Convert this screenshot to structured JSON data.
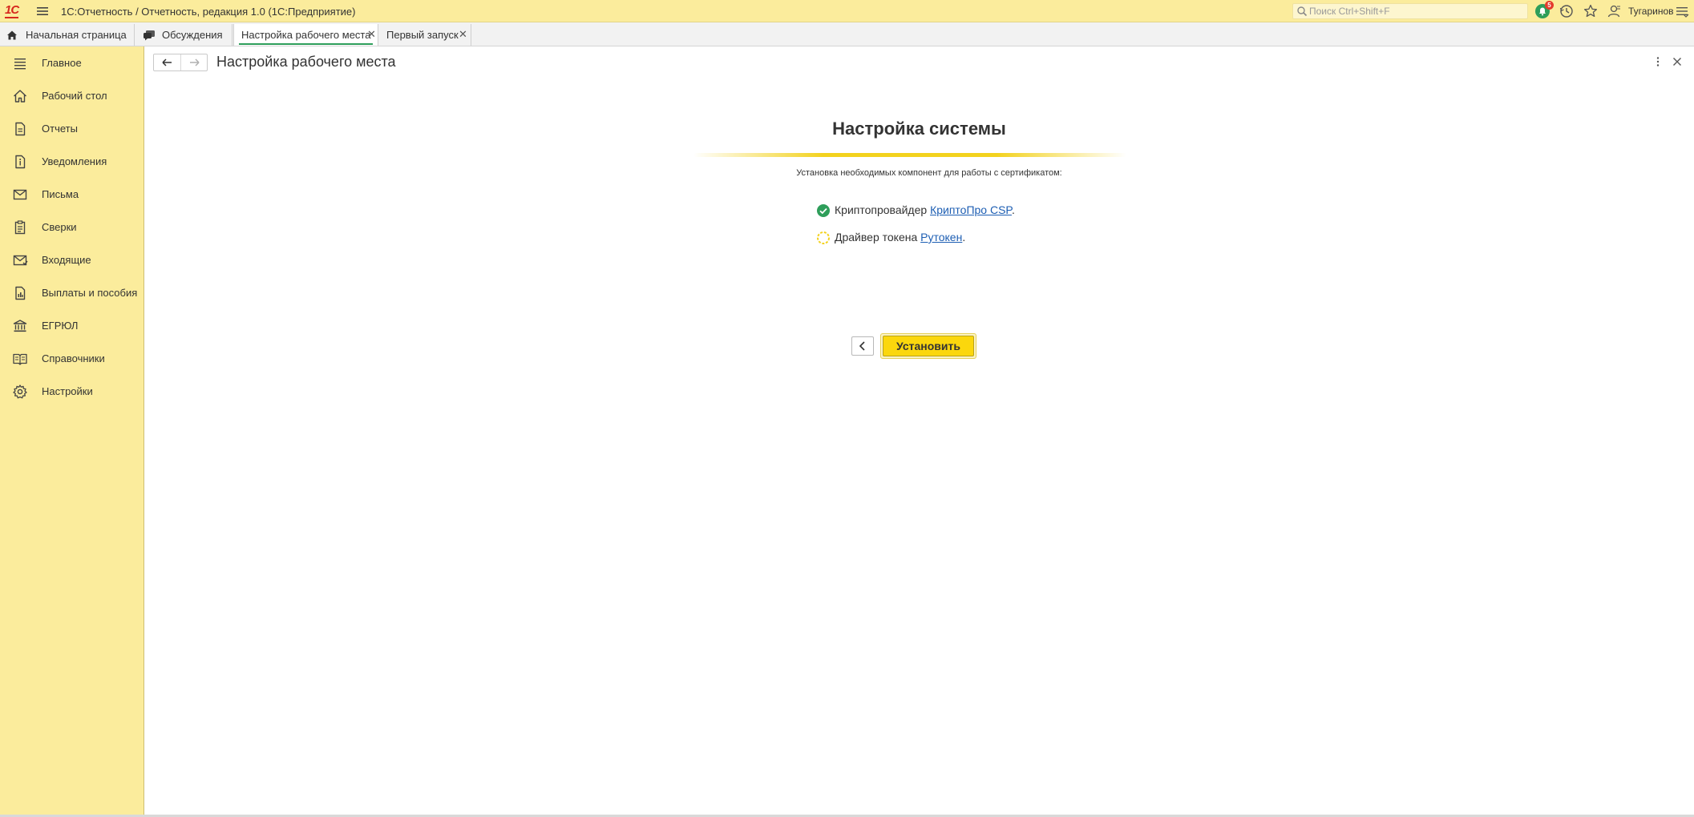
{
  "app": {
    "logo_text": "1С",
    "title": "1С:Отчетность / Отчетность, редакция 1.0  (1С:Предприятие)",
    "search_placeholder": "Поиск Ctrl+Shift+F",
    "notifications_count": "5",
    "user_name": "Тугаринов"
  },
  "tabs": [
    {
      "label": "Начальная страница",
      "icon": "home-icon"
    },
    {
      "label": "Обсуждения",
      "icon": "discussions-icon"
    },
    {
      "label": "Настройка рабочего места",
      "active": true,
      "closable": true
    },
    {
      "label": "Первый запуск",
      "closable": true
    }
  ],
  "sidebar": {
    "items": [
      {
        "label": "Главное",
        "icon": "menu-lines-icon"
      },
      {
        "label": "Рабочий стол",
        "icon": "home-icon"
      },
      {
        "label": "Отчеты",
        "icon": "document-icon"
      },
      {
        "label": "Уведомления",
        "icon": "info-document-icon"
      },
      {
        "label": "Письма",
        "icon": "envelope-icon"
      },
      {
        "label": "Сверки",
        "icon": "clipboard-icon"
      },
      {
        "label": "Входящие",
        "icon": "inbox-envelope-icon"
      },
      {
        "label": "Выплаты и пособия",
        "icon": "chart-document-icon"
      },
      {
        "label": "ЕГРЮЛ",
        "icon": "bank-icon"
      },
      {
        "label": "Справочники",
        "icon": "book-icon"
      },
      {
        "label": "Настройки",
        "icon": "gear-icon"
      }
    ]
  },
  "page": {
    "title": "Настройка рабочего места"
  },
  "setup": {
    "title": "Настройка системы",
    "subtitle": "Установка необходимых компонент для работы с сертификатом:",
    "components": [
      {
        "prefix": "Криптопровайдер ",
        "link": "КриптоПро CSP",
        "suffix": ".",
        "status": "installed"
      },
      {
        "prefix": "Драйвер токена ",
        "link": "Рутокен",
        "suffix": ".",
        "status": "pending"
      }
    ],
    "install_label": "Установить"
  },
  "colors": {
    "accent_yellow": "#fbd70d",
    "sidebar_bg": "#fbec9c",
    "link_blue": "#1d5eb3",
    "success_green": "#2e9e5a"
  }
}
